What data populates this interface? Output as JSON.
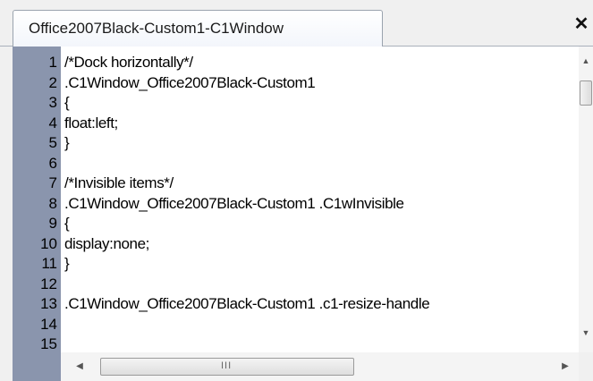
{
  "window": {
    "tab_title": "Office2007Black-Custom1-C1Window",
    "close_label": "✕"
  },
  "editor": {
    "lines": [
      {
        "n": "1",
        "text": "/*Dock horizontally*/"
      },
      {
        "n": "2",
        "text": ".C1Window_Office2007Black-Custom1"
      },
      {
        "n": "3",
        "text": "{"
      },
      {
        "n": "4",
        "text": " float:left;"
      },
      {
        "n": "5",
        "text": "}"
      },
      {
        "n": "6",
        "text": ""
      },
      {
        "n": "7",
        "text": "/*Invisible items*/"
      },
      {
        "n": "8",
        "text": ".C1Window_Office2007Black-Custom1 .C1wInvisible"
      },
      {
        "n": "9",
        "text": "{"
      },
      {
        "n": "10",
        "text": " display:none;"
      },
      {
        "n": "11",
        "text": "}"
      },
      {
        "n": "12",
        "text": ""
      },
      {
        "n": "13",
        "text": ".C1Window_Office2007Black-Custom1 .c1-resize-handle"
      },
      {
        "n": "14",
        "text": ""
      },
      {
        "n": "15",
        "text": ""
      }
    ]
  },
  "scrollbars": {
    "up_arrow": "▲",
    "down_arrow": "▼",
    "left_arrow": "◀",
    "right_arrow": "▶",
    "h_grip": "III"
  },
  "colors": {
    "gutter": "#8a95ad",
    "editor_bg": "#ffffff",
    "chrome_bg": "#f0f0f0"
  }
}
